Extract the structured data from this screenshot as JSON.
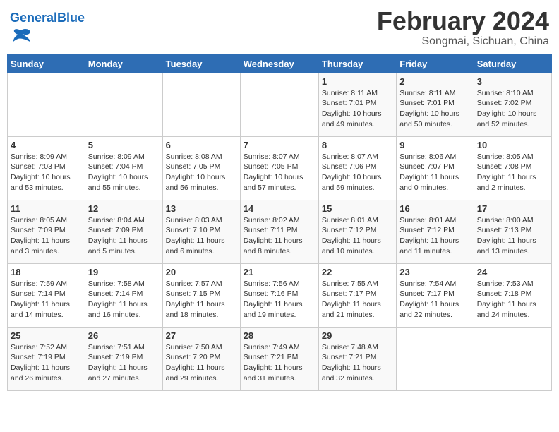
{
  "header": {
    "logo_general": "General",
    "logo_blue": "Blue",
    "month_year": "February 2024",
    "location": "Songmai, Sichuan, China"
  },
  "weekdays": [
    "Sunday",
    "Monday",
    "Tuesday",
    "Wednesday",
    "Thursday",
    "Friday",
    "Saturday"
  ],
  "weeks": [
    [
      {
        "day": "",
        "info": ""
      },
      {
        "day": "",
        "info": ""
      },
      {
        "day": "",
        "info": ""
      },
      {
        "day": "",
        "info": ""
      },
      {
        "day": "1",
        "info": "Sunrise: 8:11 AM\nSunset: 7:01 PM\nDaylight: 10 hours\nand 49 minutes."
      },
      {
        "day": "2",
        "info": "Sunrise: 8:11 AM\nSunset: 7:01 PM\nDaylight: 10 hours\nand 50 minutes."
      },
      {
        "day": "3",
        "info": "Sunrise: 8:10 AM\nSunset: 7:02 PM\nDaylight: 10 hours\nand 52 minutes."
      }
    ],
    [
      {
        "day": "4",
        "info": "Sunrise: 8:09 AM\nSunset: 7:03 PM\nDaylight: 10 hours\nand 53 minutes."
      },
      {
        "day": "5",
        "info": "Sunrise: 8:09 AM\nSunset: 7:04 PM\nDaylight: 10 hours\nand 55 minutes."
      },
      {
        "day": "6",
        "info": "Sunrise: 8:08 AM\nSunset: 7:05 PM\nDaylight: 10 hours\nand 56 minutes."
      },
      {
        "day": "7",
        "info": "Sunrise: 8:07 AM\nSunset: 7:05 PM\nDaylight: 10 hours\nand 57 minutes."
      },
      {
        "day": "8",
        "info": "Sunrise: 8:07 AM\nSunset: 7:06 PM\nDaylight: 10 hours\nand 59 minutes."
      },
      {
        "day": "9",
        "info": "Sunrise: 8:06 AM\nSunset: 7:07 PM\nDaylight: 11 hours\nand 0 minutes."
      },
      {
        "day": "10",
        "info": "Sunrise: 8:05 AM\nSunset: 7:08 PM\nDaylight: 11 hours\nand 2 minutes."
      }
    ],
    [
      {
        "day": "11",
        "info": "Sunrise: 8:05 AM\nSunset: 7:09 PM\nDaylight: 11 hours\nand 3 minutes."
      },
      {
        "day": "12",
        "info": "Sunrise: 8:04 AM\nSunset: 7:09 PM\nDaylight: 11 hours\nand 5 minutes."
      },
      {
        "day": "13",
        "info": "Sunrise: 8:03 AM\nSunset: 7:10 PM\nDaylight: 11 hours\nand 6 minutes."
      },
      {
        "day": "14",
        "info": "Sunrise: 8:02 AM\nSunset: 7:11 PM\nDaylight: 11 hours\nand 8 minutes."
      },
      {
        "day": "15",
        "info": "Sunrise: 8:01 AM\nSunset: 7:12 PM\nDaylight: 11 hours\nand 10 minutes."
      },
      {
        "day": "16",
        "info": "Sunrise: 8:01 AM\nSunset: 7:12 PM\nDaylight: 11 hours\nand 11 minutes."
      },
      {
        "day": "17",
        "info": "Sunrise: 8:00 AM\nSunset: 7:13 PM\nDaylight: 11 hours\nand 13 minutes."
      }
    ],
    [
      {
        "day": "18",
        "info": "Sunrise: 7:59 AM\nSunset: 7:14 PM\nDaylight: 11 hours\nand 14 minutes."
      },
      {
        "day": "19",
        "info": "Sunrise: 7:58 AM\nSunset: 7:14 PM\nDaylight: 11 hours\nand 16 minutes."
      },
      {
        "day": "20",
        "info": "Sunrise: 7:57 AM\nSunset: 7:15 PM\nDaylight: 11 hours\nand 18 minutes."
      },
      {
        "day": "21",
        "info": "Sunrise: 7:56 AM\nSunset: 7:16 PM\nDaylight: 11 hours\nand 19 minutes."
      },
      {
        "day": "22",
        "info": "Sunrise: 7:55 AM\nSunset: 7:17 PM\nDaylight: 11 hours\nand 21 minutes."
      },
      {
        "day": "23",
        "info": "Sunrise: 7:54 AM\nSunset: 7:17 PM\nDaylight: 11 hours\nand 22 minutes."
      },
      {
        "day": "24",
        "info": "Sunrise: 7:53 AM\nSunset: 7:18 PM\nDaylight: 11 hours\nand 24 minutes."
      }
    ],
    [
      {
        "day": "25",
        "info": "Sunrise: 7:52 AM\nSunset: 7:19 PM\nDaylight: 11 hours\nand 26 minutes."
      },
      {
        "day": "26",
        "info": "Sunrise: 7:51 AM\nSunset: 7:19 PM\nDaylight: 11 hours\nand 27 minutes."
      },
      {
        "day": "27",
        "info": "Sunrise: 7:50 AM\nSunset: 7:20 PM\nDaylight: 11 hours\nand 29 minutes."
      },
      {
        "day": "28",
        "info": "Sunrise: 7:49 AM\nSunset: 7:21 PM\nDaylight: 11 hours\nand 31 minutes."
      },
      {
        "day": "29",
        "info": "Sunrise: 7:48 AM\nSunset: 7:21 PM\nDaylight: 11 hours\nand 32 minutes."
      },
      {
        "day": "",
        "info": ""
      },
      {
        "day": "",
        "info": ""
      }
    ]
  ]
}
